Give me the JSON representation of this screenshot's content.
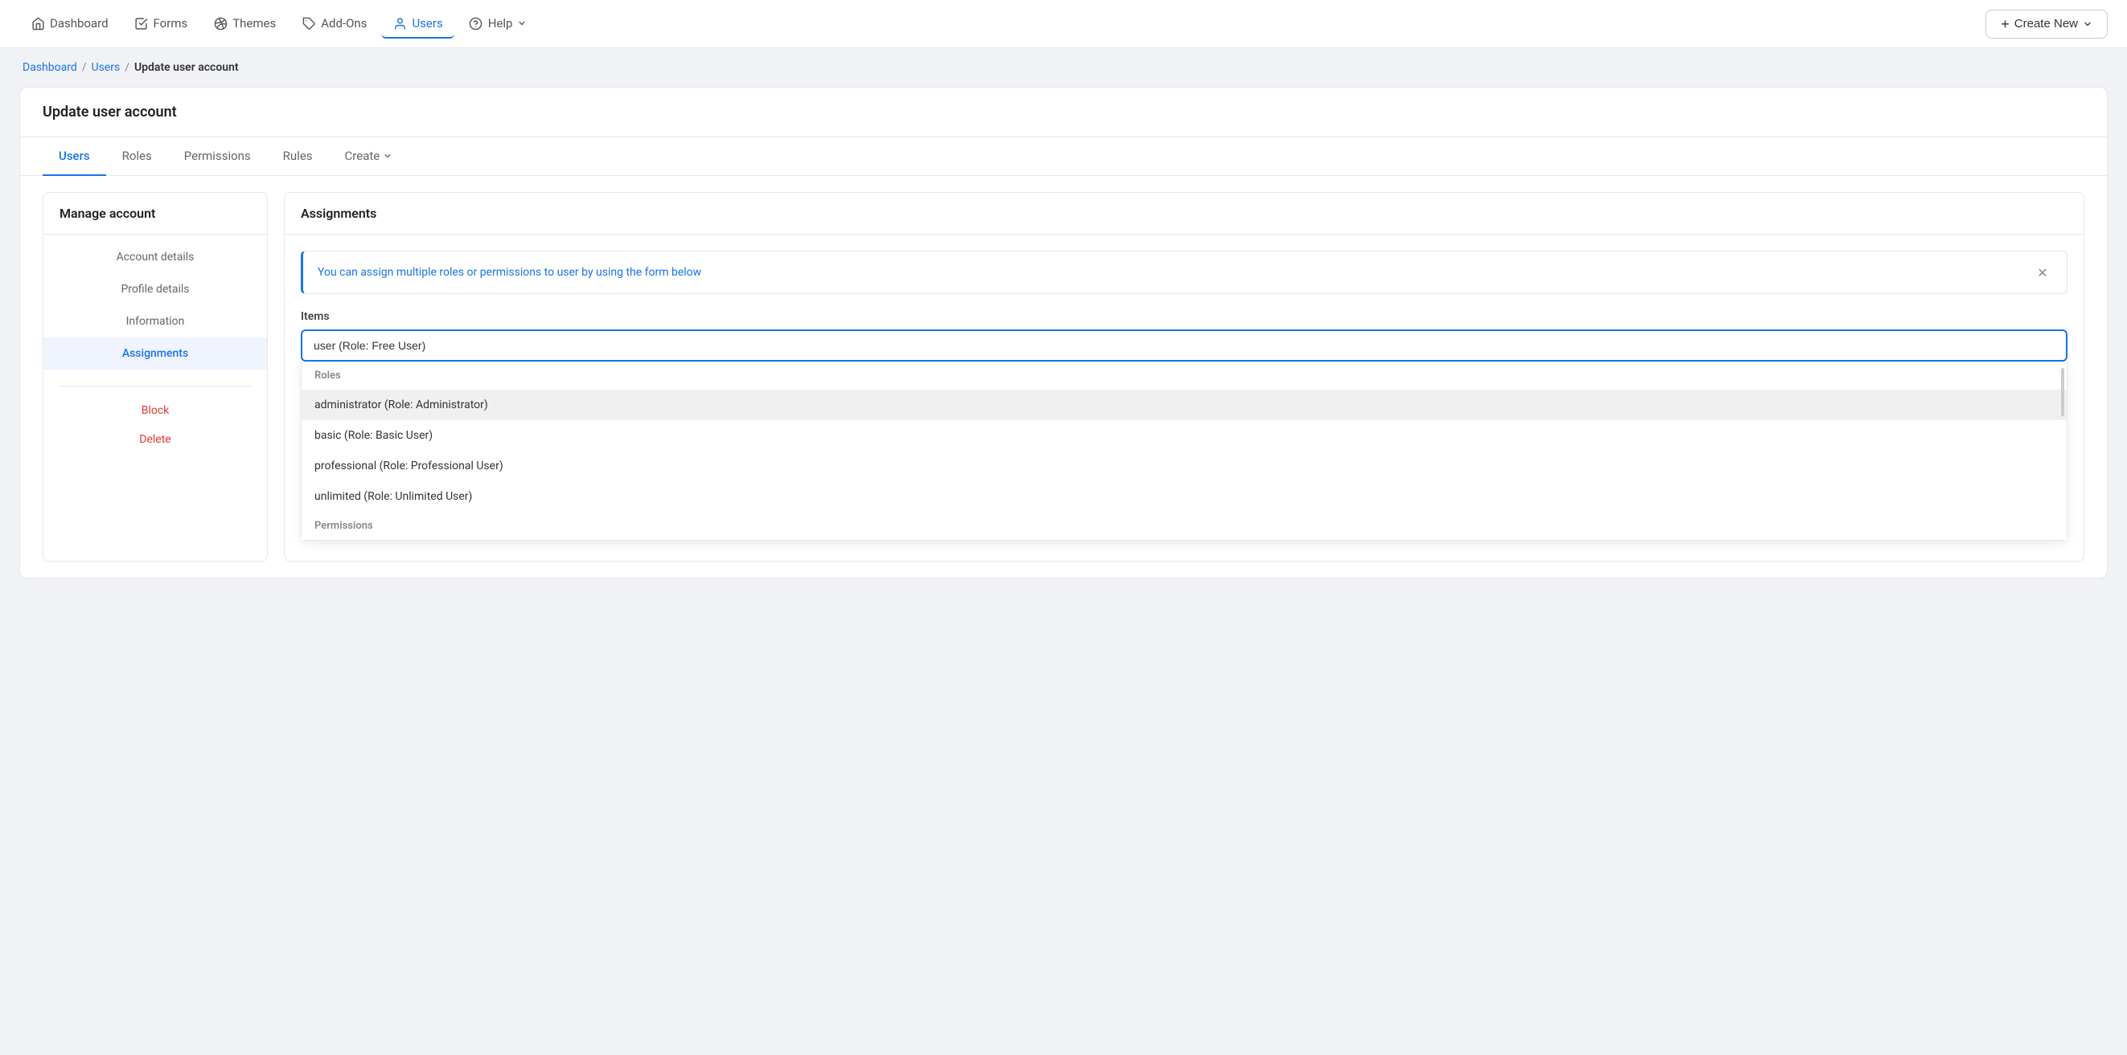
{
  "nav": {
    "items": [
      {
        "id": "dashboard",
        "label": "Dashboard",
        "icon": "home"
      },
      {
        "id": "forms",
        "label": "Forms",
        "icon": "check-square"
      },
      {
        "id": "themes",
        "label": "Themes",
        "icon": "palette"
      },
      {
        "id": "addons",
        "label": "Add-Ons",
        "icon": "puzzle"
      },
      {
        "id": "users",
        "label": "Users",
        "icon": "user",
        "active": true
      },
      {
        "id": "help",
        "label": "Help",
        "icon": "help-circle",
        "hasDropdown": true
      }
    ],
    "create_new": {
      "label": "Create New"
    }
  },
  "breadcrumb": {
    "items": [
      {
        "label": "Dashboard",
        "link": true
      },
      {
        "label": "Users",
        "link": true
      },
      {
        "label": "Update user account",
        "link": false
      }
    ]
  },
  "page": {
    "title": "Update user account"
  },
  "tabs": [
    {
      "id": "users",
      "label": "Users",
      "active": true
    },
    {
      "id": "roles",
      "label": "Roles"
    },
    {
      "id": "permissions",
      "label": "Permissions"
    },
    {
      "id": "rules",
      "label": "Rules"
    },
    {
      "id": "create",
      "label": "Create",
      "hasDropdown": true
    }
  ],
  "sidebar": {
    "title": "Manage account",
    "nav_items": [
      {
        "id": "account-details",
        "label": "Account details"
      },
      {
        "id": "profile-details",
        "label": "Profile details"
      },
      {
        "id": "information",
        "label": "Information"
      },
      {
        "id": "assignments",
        "label": "Assignments",
        "active": true
      }
    ],
    "danger_items": [
      {
        "id": "block",
        "label": "Block"
      },
      {
        "id": "delete",
        "label": "Delete"
      }
    ]
  },
  "assignments": {
    "panel_title": "Assignments",
    "info_banner": "You can assign multiple roles or permissions to user by using the form below",
    "items_label": "Items",
    "input_value": "user (Role: Free User)",
    "dropdown": {
      "groups": [
        {
          "label": "Roles",
          "items": [
            {
              "id": "administrator",
              "label": "administrator (Role: Administrator)",
              "highlighted": true
            },
            {
              "id": "basic",
              "label": "basic (Role: Basic User)"
            },
            {
              "id": "professional",
              "label": "professional (Role: Professional User)"
            },
            {
              "id": "unlimited",
              "label": "unlimited (Role: Unlimited User)"
            }
          ]
        },
        {
          "label": "Permissions",
          "items": []
        }
      ]
    }
  }
}
